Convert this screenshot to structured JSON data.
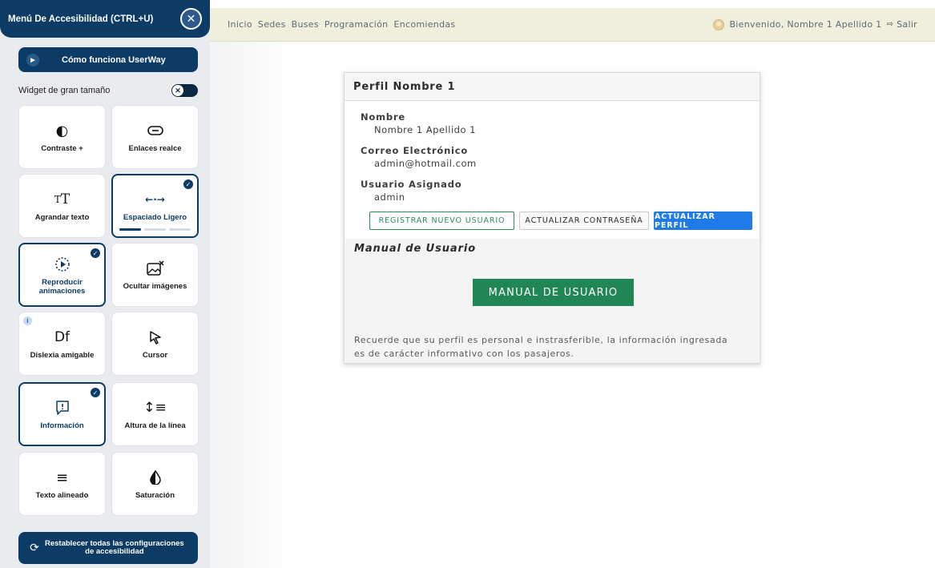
{
  "navbar": {
    "links": [
      "Inicio",
      "Sedes",
      "Buses",
      "Programación",
      "Encomiendas"
    ],
    "welcome": "Bienvenido, Nombre 1 Apellido 1",
    "logout": "Salir"
  },
  "a11y": {
    "title": "Menú De Accesibilidad (CTRL+U)",
    "close_symbol": "✕",
    "how_it_works": "Cómo funciona UserWay",
    "big_widget_label": "Widget de gran tamaño",
    "tiles": [
      {
        "label": "Contraste +",
        "active": false
      },
      {
        "label": "Enlaces realce",
        "active": false
      },
      {
        "label": "Agrandar texto",
        "active": false
      },
      {
        "label": "Espaciado Ligero",
        "active": true
      },
      {
        "label": "Reproducir animaciones",
        "active": true
      },
      {
        "label": "Ocultar imágenes",
        "active": false
      },
      {
        "label": "Dislexia amigable",
        "active": false
      },
      {
        "label": "Cursor",
        "active": false
      },
      {
        "label": "Información",
        "active": true
      },
      {
        "label": "Altura de la línea",
        "active": false
      },
      {
        "label": "Texto alineado",
        "active": false
      },
      {
        "label": "Saturación",
        "active": false
      }
    ],
    "spacing_level": "1 of 3",
    "reset_label": "Restablecer todas las configuraciones de accesibilidad",
    "accent_color": "#0c3b66"
  },
  "profile": {
    "title": "Perfil Nombre 1",
    "fields": [
      {
        "label": "Nombre",
        "value": "Nombre 1 Apellido 1"
      },
      {
        "label": "Correo Electrónico",
        "value": "admin@hotmail.com"
      },
      {
        "label": "Usuario Asignado",
        "value": "admin"
      }
    ],
    "buttons": {
      "register": "REGISTRAR NUEVO USUARIO",
      "update_password": "ACTUALIZAR CONTRASEÑA",
      "update_profile": "ACTUALIZAR PERFIL"
    },
    "manual_title": "Manual de Usuario",
    "manual_button": "MANUAL DE USUARIO",
    "notice": "Recuerde que su perfil es personal e instrasferible, la información ingresada es de carácter informativo con los pasajeros."
  }
}
